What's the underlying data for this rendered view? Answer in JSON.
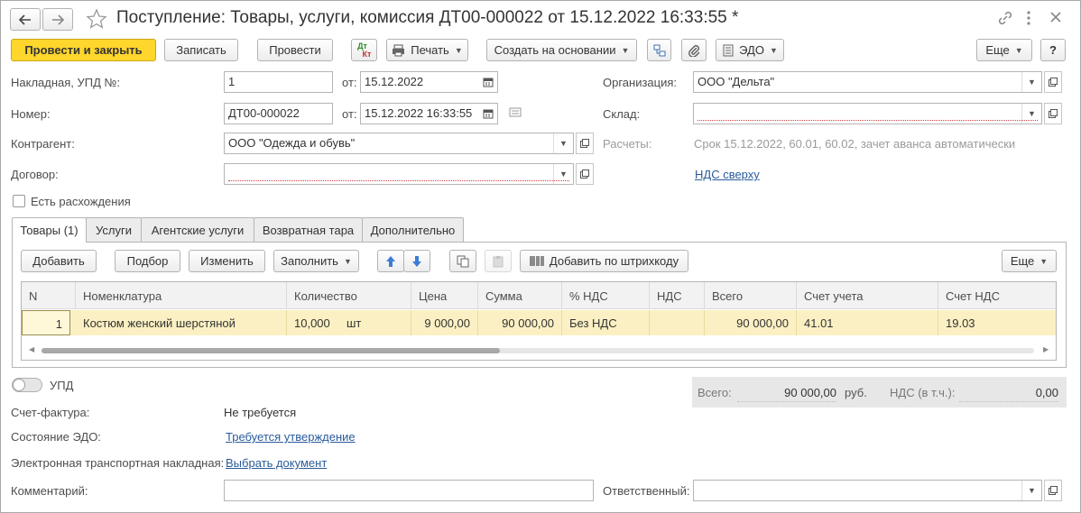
{
  "window": {
    "title": "Поступление: Товары, услуги, комиссия ДТ00-000022 от 15.12.2022 16:33:55 *"
  },
  "toolbar": {
    "post_close": "Провести и закрыть",
    "save": "Записать",
    "post": "Провести",
    "dtkt_top": "Дт",
    "dtkt_bottom": "Кт",
    "print": "Печать",
    "create_based": "Создать на основании",
    "edo": "ЭДО",
    "more": "Еще",
    "help": "?"
  },
  "form": {
    "invoice_label": "Накладная, УПД №:",
    "invoice_number": "1",
    "from_label": "от:",
    "invoice_date": "15.12.2022",
    "number_label": "Номер:",
    "number": "ДТ00-000022",
    "number_date": "15.12.2022 16:33:55",
    "counterparty_label": "Контрагент:",
    "counterparty": "ООО \"Одежда и обувь\"",
    "contract_label": "Договор:",
    "contract": "",
    "organization_label": "Организация:",
    "organization": "ООО \"Дельта\"",
    "warehouse_label": "Склад:",
    "warehouse": "",
    "settlements_label": "Расчеты:",
    "settlements": "Срок 15.12.2022, 60.01, 60.02, зачет аванса автоматически",
    "vat_link": "НДС сверху",
    "discrepancies_label": "Есть расхождения"
  },
  "tabs": [
    {
      "label": "Товары (1)"
    },
    {
      "label": "Услуги"
    },
    {
      "label": "Агентские услуги"
    },
    {
      "label": "Возвратная тара"
    },
    {
      "label": "Дополнительно"
    }
  ],
  "table_toolbar": {
    "add": "Добавить",
    "select": "Подбор",
    "edit": "Изменить",
    "fill": "Заполнить",
    "barcode": "Добавить по штрихкоду",
    "more": "Еще"
  },
  "table": {
    "columns": [
      "N",
      "Номенклатура",
      "Количество",
      "Цена",
      "Сумма",
      "% НДС",
      "НДС",
      "Всего",
      "Счет учета",
      "Счет НДС"
    ],
    "rows": [
      {
        "n": "1",
        "item": "Костюм женский шерстяной",
        "qty": "10,000",
        "unit": "шт",
        "price": "9 000,00",
        "sum": "90 000,00",
        "vat_rate": "Без НДС",
        "vat": "",
        "total": "90 000,00",
        "account": "41.01",
        "vat_account": "19.03"
      }
    ]
  },
  "footer": {
    "upd_label": "УПД",
    "upd_on": false,
    "total_label": "Всего:",
    "total_value": "90 000,00",
    "currency": "руб.",
    "vat_incl_label": "НДС (в т.ч.):",
    "vat_incl_value": "0,00",
    "invoice_label": "Счет-фактура:",
    "invoice_value": "Не требуется",
    "edo_state_label": "Состояние ЭДО:",
    "edo_state_value": "Требуется утверждение",
    "etn_label": "Электронная транспортная накладная:",
    "etn_value": "Выбрать документ",
    "comment_label": "Комментарий:",
    "comment_value": "",
    "responsible_label": "Ответственный:",
    "responsible_value": ""
  },
  "colors": {
    "primary_button": "#ffd62c",
    "selected_row": "#fbf0c3",
    "link": "#2a5b9c",
    "required_underline": "#d04040"
  }
}
